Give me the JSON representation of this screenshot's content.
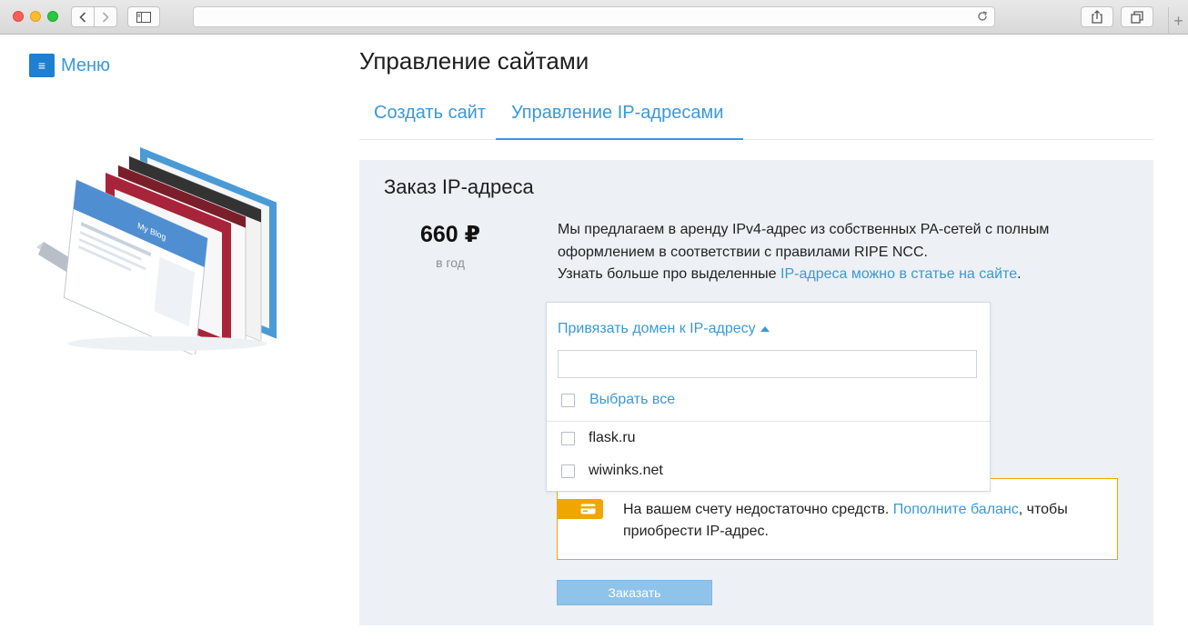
{
  "menu": {
    "label": "Меню"
  },
  "page": {
    "title": "Управление сайтами"
  },
  "tabs": [
    {
      "label": "Создать сайт",
      "active": false
    },
    {
      "label": "Управление IP-адресами",
      "active": true
    }
  ],
  "panel": {
    "title": "Заказ IP-адреса",
    "price": "660 ₽",
    "period": "в год",
    "description": {
      "line1": "Мы предлагаем в аренду IPv4-адрес из собственных PA-сетей с полным оформлением в соответствии с правилами RIPE NCC.",
      "line2_text": "Узнать больше про выделенные ",
      "line2_link": "IP-адреса можно в статье на сайте",
      "line2_end": "."
    }
  },
  "dropdown": {
    "toggle_label": "Привязать домен к IP-адресу",
    "search_value": "",
    "select_all_label": "Выбрать все",
    "domains": [
      "flask.ru",
      "wiwinks.net"
    ]
  },
  "warning": {
    "text": "На вашем счету недостаточно средств. ",
    "link": "Пополните баланс",
    "text_end": ", чтобы приобрести IP-адрес."
  },
  "order_button": {
    "label": "Заказать"
  },
  "colors": {
    "accent": "#3a99d8",
    "warning": "#f0a500",
    "panel_bg": "#edf0f4",
    "button_disabled": "#8fc3ea"
  },
  "icons": {
    "menu": "hamburger-icon",
    "warning": "credit-card-icon"
  }
}
